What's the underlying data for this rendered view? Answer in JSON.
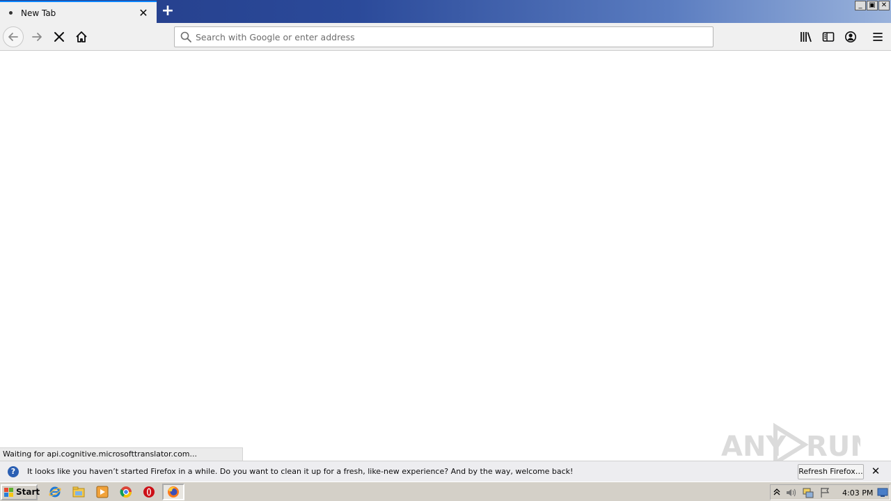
{
  "window": {
    "minimize_label": "_",
    "restore_label": "▣",
    "close_label": "✕"
  },
  "tabs": [
    {
      "title": "New Tab",
      "close": "✕",
      "loading": true
    }
  ],
  "new_tab_label": "+",
  "toolbar": {
    "icons": [
      "back-arrow-icon",
      "forward-arrow-icon",
      "stop-icon",
      "home-icon",
      "library-icon",
      "sidebar-icon",
      "account-icon",
      "menu-icon"
    ]
  },
  "urlbar": {
    "placeholder": "Search with Google or enter address",
    "value": ""
  },
  "status": {
    "text": "Waiting for api.cognitive.microsofttranslator.com..."
  },
  "notification": {
    "icon": "?",
    "message": "It looks like you haven’t started Firefox in a while. Do you want to clean it up for a fresh, like-new experience? And by the way, welcome back!",
    "button_label": "Refresh Firefox…",
    "close": "✕"
  },
  "watermark": {
    "text_left": "ANY",
    "text_right": "RUN"
  },
  "taskbar": {
    "start_label": "Start",
    "apps": [
      "internet-explorer-icon",
      "file-explorer-icon",
      "media-player-icon",
      "chrome-icon",
      "opera-icon",
      "firefox-icon"
    ],
    "clock": "4:03 PM"
  },
  "colors": {
    "accent": "#0a84ff",
    "titlebar_dark": "#233b86",
    "titlebar_light": "#9ab3dc",
    "toolbar_bg": "#f0f0f0",
    "taskbar_bg": "#d4d0c8"
  }
}
